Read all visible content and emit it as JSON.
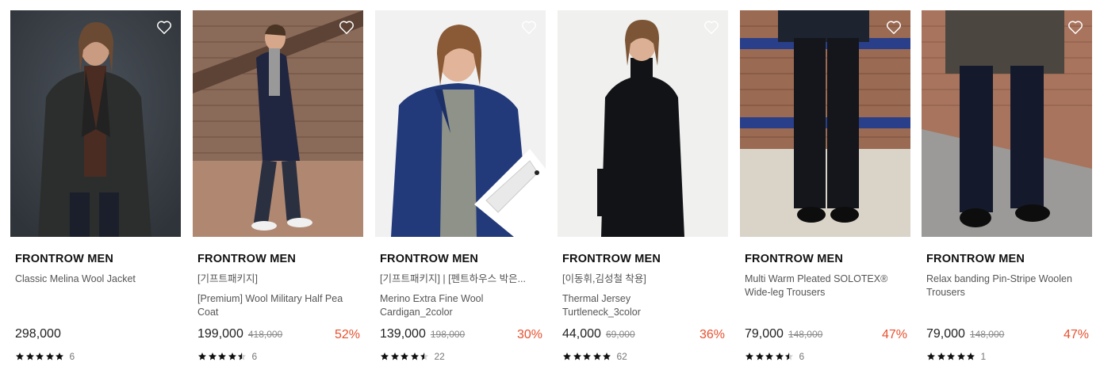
{
  "heart_icon": "heart-outline",
  "accent_discount_color": "#e8502e",
  "products": [
    {
      "brand": "FRONTROW MEN",
      "names": [
        "Classic Melina Wool Jacket"
      ],
      "price": "298,000",
      "original_price": "",
      "discount": "",
      "rating": 5,
      "review_count": "6"
    },
    {
      "brand": "FRONTROW MEN",
      "names": [
        "[기프트패키지]",
        "[Premium] Wool Military Half Pea Coat"
      ],
      "price": "199,000",
      "original_price": "418,000",
      "discount": "52%",
      "rating": 4.5,
      "review_count": "6"
    },
    {
      "brand": "FRONTROW MEN",
      "names": [
        "[기프트패키지] | [펜트하우스 박은...",
        "Merino Extra Fine Wool Cardigan_2color"
      ],
      "price": "139,000",
      "original_price": "198,000",
      "discount": "30%",
      "rating": 4.5,
      "review_count": "22"
    },
    {
      "brand": "FRONTROW MEN",
      "names": [
        "[이동휘,김성철 착용]",
        "Thermal Jersey Turtleneck_3color"
      ],
      "price": "44,000",
      "original_price": "69,000",
      "discount": "36%",
      "rating": 5,
      "review_count": "62"
    },
    {
      "brand": "FRONTROW MEN",
      "names": [
        "Multi Warm Pleated SOLOTEX® Wide-leg Trousers"
      ],
      "price": "79,000",
      "original_price": "148,000",
      "discount": "47%",
      "rating": 4.5,
      "review_count": "6"
    },
    {
      "brand": "FRONTROW MEN",
      "names": [
        "Relax banding Pin-Stripe Woolen Trousers"
      ],
      "price": "79,000",
      "original_price": "148,000",
      "discount": "47%",
      "rating": 5,
      "review_count": "1"
    }
  ]
}
